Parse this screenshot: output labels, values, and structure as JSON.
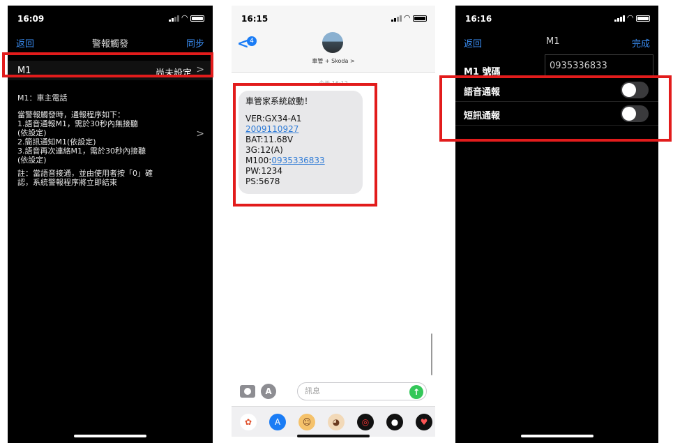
{
  "phone1": {
    "time": "16:09",
    "nav": {
      "back": "返回",
      "title": "警報觸發",
      "sync": "同步"
    },
    "row": {
      "key": "M1",
      "value": "尚未設定"
    },
    "heading": "M1：車主電話",
    "body": "當警報觸發時，通報程序如下：\n1.語音通報M1，需於30秒內無接聽\n(依設定)\n2.簡訊通知M1(依設定)\n3.語音再次連絡M1，需於30秒內接聽\n(依設定)",
    "note": "註：當語音接通，並由使用者按「0」確\n認，系統警報程序將立即結束"
  },
  "phone2": {
    "time": "16:15",
    "badge": "4",
    "contact": "車管 + Skoda >",
    "timestamp": "今天 16:12",
    "message": {
      "title": "車管家系統啟動！",
      "ver_prefix": "VER:GX34-A1 ",
      "ver_link": "2009110927",
      "bat": "BAT:11.68V",
      "net": "3G:12(A)",
      "m100_prefix": "M100:",
      "m100_link": "0935336833",
      "pw": "PW:1234",
      "ps": "PS:5678"
    },
    "input_placeholder": "訊息"
  },
  "phone3": {
    "time": "16:16",
    "nav": {
      "back": "返回",
      "title": "M1",
      "done": "完成"
    },
    "number_label": "M1 號碼",
    "number_value": "0935336833",
    "voice_label": "語音通報",
    "sms_label": "短訊通報",
    "voice_on": false,
    "sms_on": false
  },
  "colors": {
    "highlight": "#e21c1c",
    "link": "#3a8ef5"
  }
}
